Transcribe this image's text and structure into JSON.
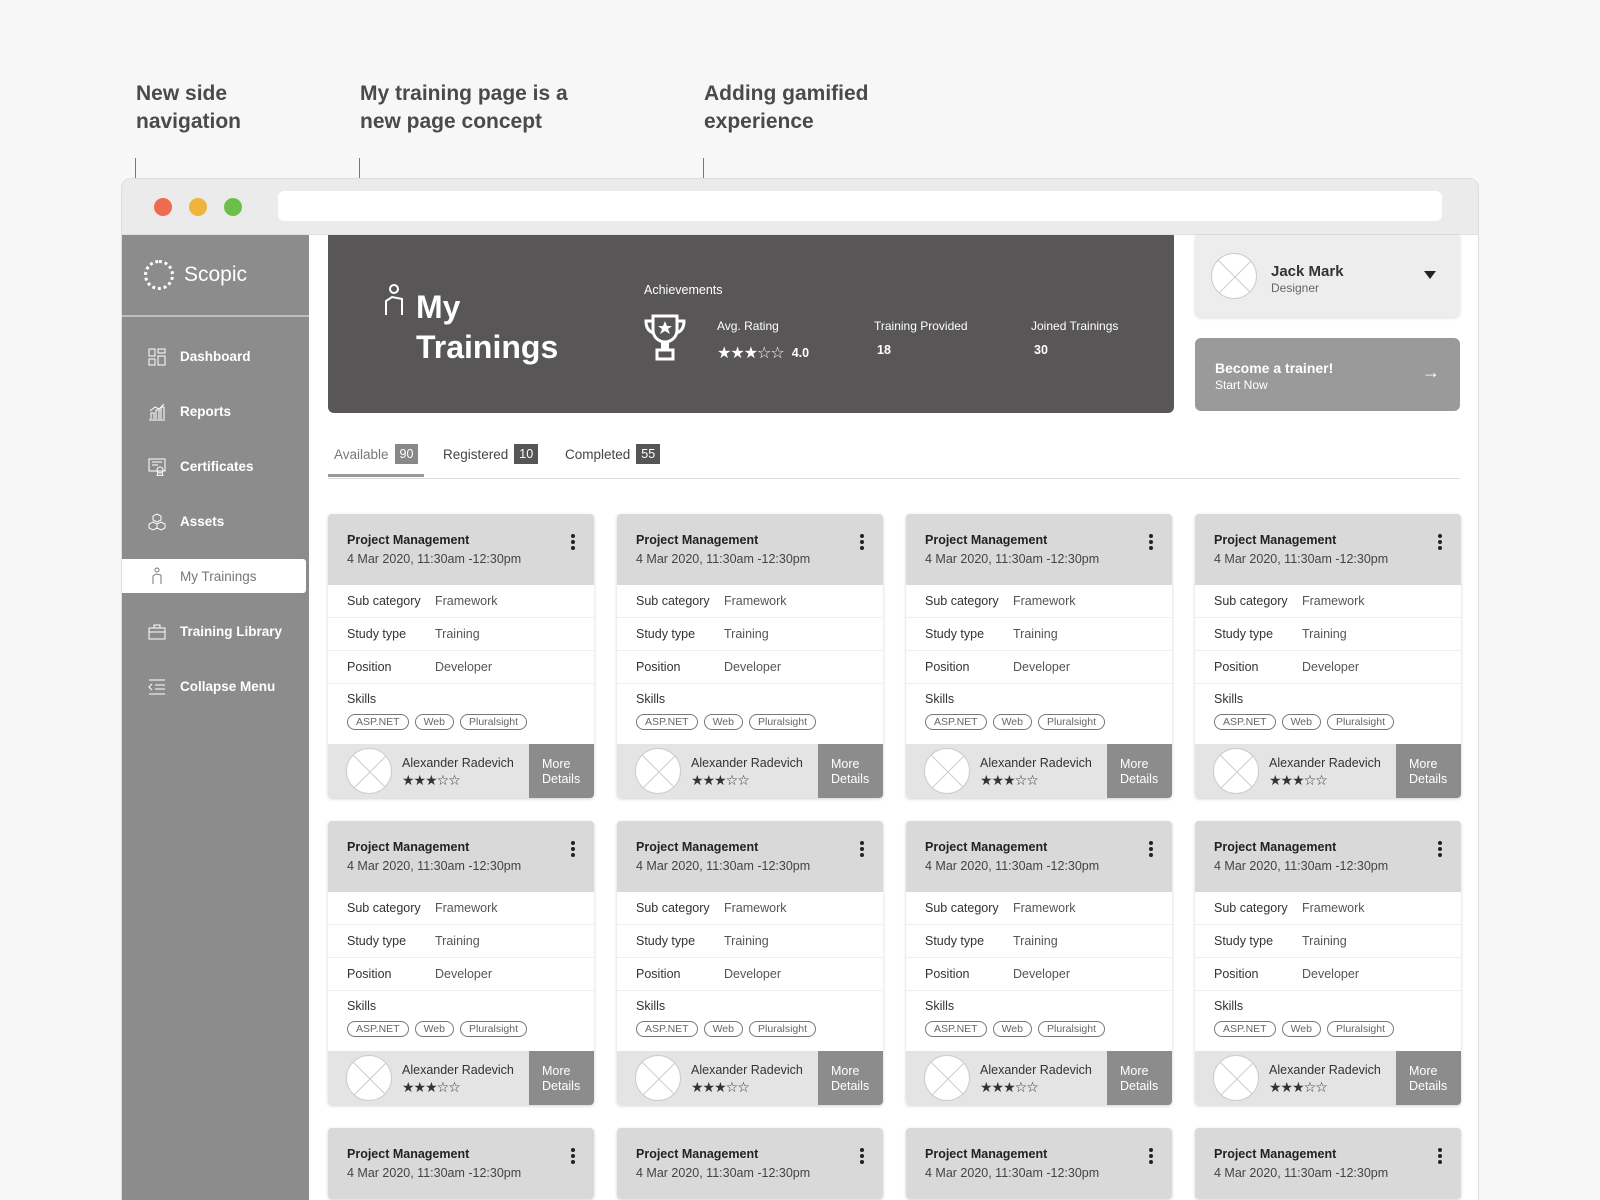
{
  "annotations": [
    {
      "text_line1": "New side",
      "text_line2": "navigation"
    },
    {
      "text_line1": "My training page is a",
      "text_line2": "new page concept"
    },
    {
      "text_line1": "Adding gamified",
      "text_line2": "experience"
    }
  ],
  "brand": {
    "name": "Scopic"
  },
  "nav": [
    {
      "label": "Dashboard",
      "icon": "dashboard-icon"
    },
    {
      "label": "Reports",
      "icon": "reports-icon"
    },
    {
      "label": "Certificates",
      "icon": "certificate-icon"
    },
    {
      "label": "Assets",
      "icon": "assets-icon"
    },
    {
      "label": "My Trainings",
      "icon": "hand-icon",
      "active": true
    },
    {
      "label": "Training Library",
      "icon": "briefcase-icon"
    },
    {
      "label": "Collapse Menu",
      "icon": "collapse-icon"
    }
  ],
  "hero": {
    "title_line1": "My",
    "title_line2": "Trainings",
    "achievements_label": "Achievements",
    "avg_rating_label": "Avg. Rating",
    "avg_rating_value": "4.0",
    "avg_rating_stars": "★★★☆☆",
    "training_provided_label": "Training Provided",
    "training_provided_value": "18",
    "joined_trainings_label": "Joined Trainings",
    "joined_trainings_value": "30"
  },
  "profile": {
    "name": "Jack Mark",
    "role": "Designer"
  },
  "trainer_cta": {
    "title": "Become a trainer!",
    "subtitle": "Start Now",
    "arrow": "→"
  },
  "tabs": [
    {
      "label": "Available",
      "count": "90",
      "active": true
    },
    {
      "label": "Registered",
      "count": "10"
    },
    {
      "label": "Completed",
      "count": "55"
    }
  ],
  "card_labels": {
    "sub_category": "Sub category",
    "study_type": "Study type",
    "position": "Position",
    "skills": "Skills",
    "more_line1": "More",
    "more_line2": "Details"
  },
  "cards": [
    {
      "title": "Project Management",
      "date": "4 Mar 2020, 11:30am -12:30pm",
      "sub_category": "Framework",
      "study_type": "Training",
      "position": "Developer",
      "skills": [
        "ASP.NET",
        "Web",
        "Pluralsight"
      ],
      "trainer": "Alexander Radevich",
      "stars": "★★★☆☆"
    },
    {
      "title": "Project Management",
      "date": "4 Mar 2020, 11:30am -12:30pm",
      "sub_category": "Framework",
      "study_type": "Training",
      "position": "Developer",
      "skills": [
        "ASP.NET",
        "Web",
        "Pluralsight"
      ],
      "trainer": "Alexander Radevich",
      "stars": "★★★☆☆"
    },
    {
      "title": "Project Management",
      "date": "4 Mar 2020, 11:30am -12:30pm",
      "sub_category": "Framework",
      "study_type": "Training",
      "position": "Developer",
      "skills": [
        "ASP.NET",
        "Web",
        "Pluralsight"
      ],
      "trainer": "Alexander Radevich",
      "stars": "★★★☆☆"
    },
    {
      "title": "Project Management",
      "date": "4 Mar 2020, 11:30am -12:30pm",
      "sub_category": "Framework",
      "study_type": "Training",
      "position": "Developer",
      "skills": [
        "ASP.NET",
        "Web",
        "Pluralsight"
      ],
      "trainer": "Alexander Radevich",
      "stars": "★★★☆☆"
    },
    {
      "title": "Project Management",
      "date": "4 Mar 2020, 11:30am -12:30pm",
      "sub_category": "Framework",
      "study_type": "Training",
      "position": "Developer",
      "skills": [
        "ASP.NET",
        "Web",
        "Pluralsight"
      ],
      "trainer": "Alexander Radevich",
      "stars": "★★★☆☆"
    },
    {
      "title": "Project Management",
      "date": "4 Mar 2020, 11:30am -12:30pm",
      "sub_category": "Framework",
      "study_type": "Training",
      "position": "Developer",
      "skills": [
        "ASP.NET",
        "Web",
        "Pluralsight"
      ],
      "trainer": "Alexander Radevich",
      "stars": "★★★☆☆"
    },
    {
      "title": "Project Management",
      "date": "4 Mar 2020, 11:30am -12:30pm",
      "sub_category": "Framework",
      "study_type": "Training",
      "position": "Developer",
      "skills": [
        "ASP.NET",
        "Web",
        "Pluralsight"
      ],
      "trainer": "Alexander Radevich",
      "stars": "★★★☆☆"
    },
    {
      "title": "Project Management",
      "date": "4 Mar 2020, 11:30am -12:30pm",
      "sub_category": "Framework",
      "study_type": "Training",
      "position": "Developer",
      "skills": [
        "ASP.NET",
        "Web",
        "Pluralsight"
      ],
      "trainer": "Alexander Radevich",
      "stars": "★★★☆☆"
    },
    {
      "title": "Project Management",
      "date": "4 Mar 2020, 11:30am -12:30pm"
    },
    {
      "title": "Project Management",
      "date": "4 Mar 2020, 11:30am -12:30pm"
    },
    {
      "title": "Project Management",
      "date": "4 Mar 2020, 11:30am -12:30pm"
    },
    {
      "title": "Project Management",
      "date": "4 Mar 2020, 11:30am -12:30pm"
    }
  ],
  "colors": {
    "traffic_red": "#ee6b52",
    "traffic_yellow": "#f0b43c",
    "traffic_green": "#6cc04a",
    "sidebar": "#8c8c8c",
    "hero": "#585656"
  }
}
